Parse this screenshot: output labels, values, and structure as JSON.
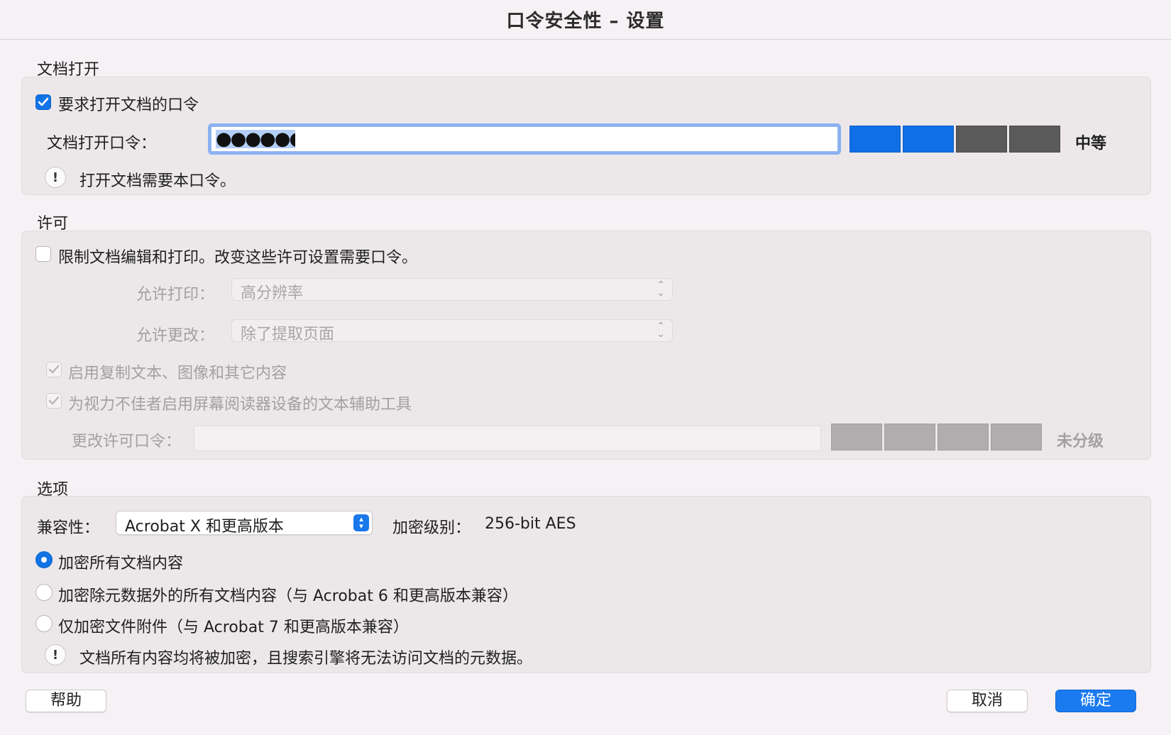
{
  "window": {
    "title": "口令安全性 – 设置"
  },
  "open_section": {
    "label": "文档打开",
    "require_checkbox_label": "要求打开文档的口令",
    "require_checked": true,
    "password_label": "文档打开口令：",
    "password_value": "●●●●●●●●●",
    "strength_text": "中等",
    "strength_level": 2,
    "strength_total": 4,
    "note": "打开文档需要本口令。"
  },
  "permissions_section": {
    "label": "许可",
    "restrict_checkbox_label": "限制文档编辑和打印。改变这些许可设置需要口令。",
    "restrict_checked": false,
    "print_label": "允许打印：",
    "print_value": "高分辨率",
    "change_label": "允许更改：",
    "change_value": "除了提取页面",
    "copy_label": "启用复制文本、图像和其它内容",
    "copy_checked": true,
    "accessibility_label": "为视力不佳者启用屏幕阅读器设备的文本辅助工具",
    "accessibility_checked": true,
    "perm_password_label": "更改许可口令：",
    "perm_strength_text": "未分级"
  },
  "options_section": {
    "label": "选项",
    "compat_label": "兼容性：",
    "compat_value": "Acrobat X 和更高版本",
    "encryption_label": "加密级别：",
    "encryption_value": "256-bit AES",
    "radio_all": "加密所有文档内容",
    "radio_except_metadata": "加密除元数据外的所有文档内容（与 Acrobat 6 和更高版本兼容）",
    "radio_attachments": "仅加密文件附件（与 Acrobat 7 和更高版本兼容）",
    "selected_radio": "radio_all",
    "note": "文档所有内容均将被加密，且搜索引擎将无法访问文档的元数据。"
  },
  "buttons": {
    "help": "帮助",
    "cancel": "取消",
    "ok": "确定"
  },
  "colors": {
    "accent": "#1273e6",
    "meter_filled": "#0f6fe6",
    "meter_empty": "#5a5a5a",
    "meter_disabled": "#b0adaf"
  }
}
